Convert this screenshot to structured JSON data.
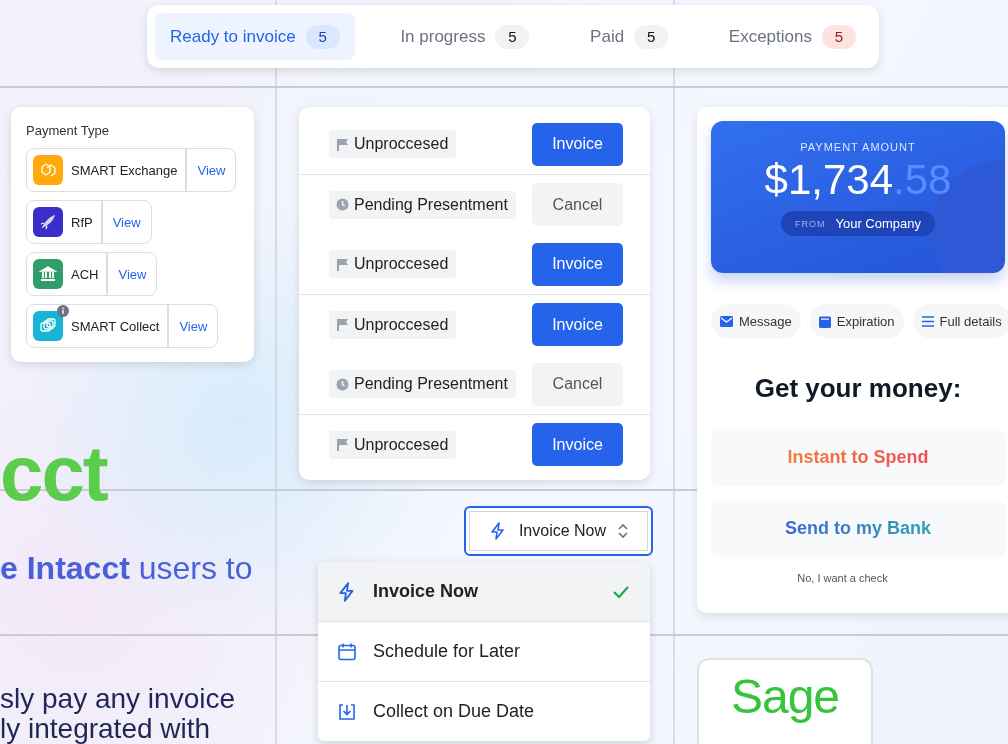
{
  "tabs": [
    {
      "label": "Ready to invoice",
      "count": "5",
      "selected": true,
      "kind": "normal"
    },
    {
      "label": "In progress",
      "count": "5",
      "selected": false,
      "kind": "normal"
    },
    {
      "label": "Paid",
      "count": "5",
      "selected": false,
      "kind": "normal"
    },
    {
      "label": "Exceptions",
      "count": "5",
      "selected": false,
      "kind": "alert"
    }
  ],
  "payment_types": {
    "title": "Payment Type",
    "items": [
      {
        "name": "SMART Exchange",
        "action": "View",
        "color": "#ffa90a",
        "kind": "exchange",
        "info": false
      },
      {
        "name": "RfP",
        "action": "View",
        "color": "#3b2fc9",
        "kind": "rocket",
        "info": false
      },
      {
        "name": "ACH",
        "action": "View",
        "color": "#2f9e6a",
        "kind": "bank",
        "info": false
      },
      {
        "name": "SMART Collect",
        "action": "View",
        "color": "#17b4d6",
        "kind": "collect",
        "info": true
      }
    ]
  },
  "invoices": [
    {
      "status": "Unproccesed",
      "kind": "unprocessed",
      "action": "Invoice"
    },
    {
      "status": "Pending Presentment",
      "kind": "pending",
      "action": "Cancel"
    },
    {
      "status": "Unproccesed",
      "kind": "unprocessed",
      "action": "Invoice"
    },
    {
      "status": "Unproccesed",
      "kind": "unprocessed",
      "action": "Invoice"
    },
    {
      "status": "Pending Presentment",
      "kind": "pending",
      "action": "Cancel"
    },
    {
      "status": "Unproccesed",
      "kind": "unprocessed",
      "action": "Invoice"
    }
  ],
  "hero": {
    "brand": "cct",
    "subtitle": "**e Intacct** users to",
    "body_lines": [
      "sly pay any invoice",
      "ly integrated with"
    ]
  },
  "select": {
    "value": "Invoice Now",
    "options": [
      {
        "label": "Invoice Now",
        "kind": "bolt",
        "selected": true
      },
      {
        "label": "Schedule for Later",
        "kind": "calendar",
        "selected": false
      },
      {
        "label": "Collect on Due Date",
        "kind": "download",
        "selected": false
      }
    ]
  },
  "payment": {
    "label": "PAYMENT AMOUNT",
    "amount": "$1,734",
    "cents": ".58",
    "from_label": "FROM",
    "from": "Your Company",
    "chips": [
      {
        "label": "Message",
        "kind": "mail"
      },
      {
        "label": "Expiration",
        "kind": "calendar"
      },
      {
        "label": "Full details",
        "kind": "list"
      }
    ],
    "heading": "Get your money:",
    "options": [
      {
        "label": "Instant to Spend",
        "kind": "instant"
      },
      {
        "label": "Send to my Bank",
        "kind": "bank"
      }
    ],
    "decline": "No, I want a check"
  },
  "logo": {
    "text": "Sage"
  }
}
